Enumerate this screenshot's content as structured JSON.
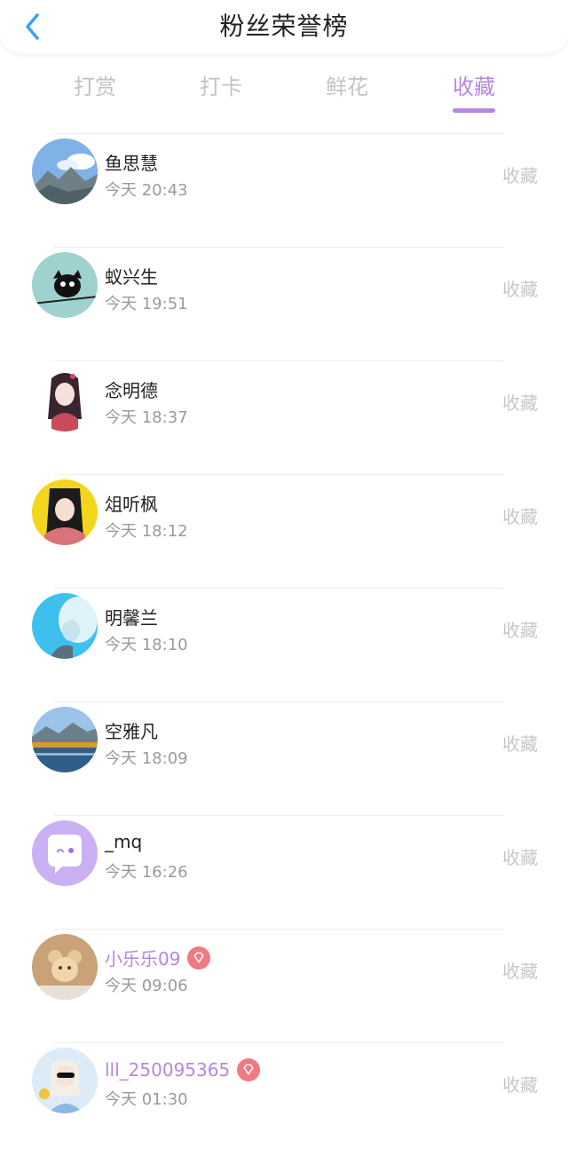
{
  "header": {
    "title": "粉丝荣誉榜"
  },
  "tabs": [
    {
      "label": "打赏"
    },
    {
      "label": "打卡"
    },
    {
      "label": "鲜花"
    },
    {
      "label": "收藏"
    }
  ],
  "entries": [
    {
      "name": "鱼思慧",
      "time": "今天 20:43",
      "action": "收藏"
    },
    {
      "name": "蚁兴生",
      "time": "今天 19:51",
      "action": "收藏"
    },
    {
      "name": "念明德",
      "time": "今天 18:37",
      "action": "收藏"
    },
    {
      "name": "俎听枫",
      "time": "今天 18:12",
      "action": "收藏"
    },
    {
      "name": "明馨兰",
      "time": "今天 18:10",
      "action": "收藏"
    },
    {
      "name": "空雅凡",
      "time": "今天 18:09",
      "action": "收藏"
    },
    {
      "name": "_mq",
      "time": "今天 16:26",
      "action": "收藏"
    },
    {
      "name": "小乐乐09",
      "time": "今天 09:06",
      "action": "收藏"
    },
    {
      "name": "lll_250095365",
      "time": "今天 01:30",
      "action": "收藏"
    }
  ],
  "colors": {
    "accent": "#b587df",
    "vip_badge": "#f07a82",
    "back_icon": "#3aa0ff"
  }
}
